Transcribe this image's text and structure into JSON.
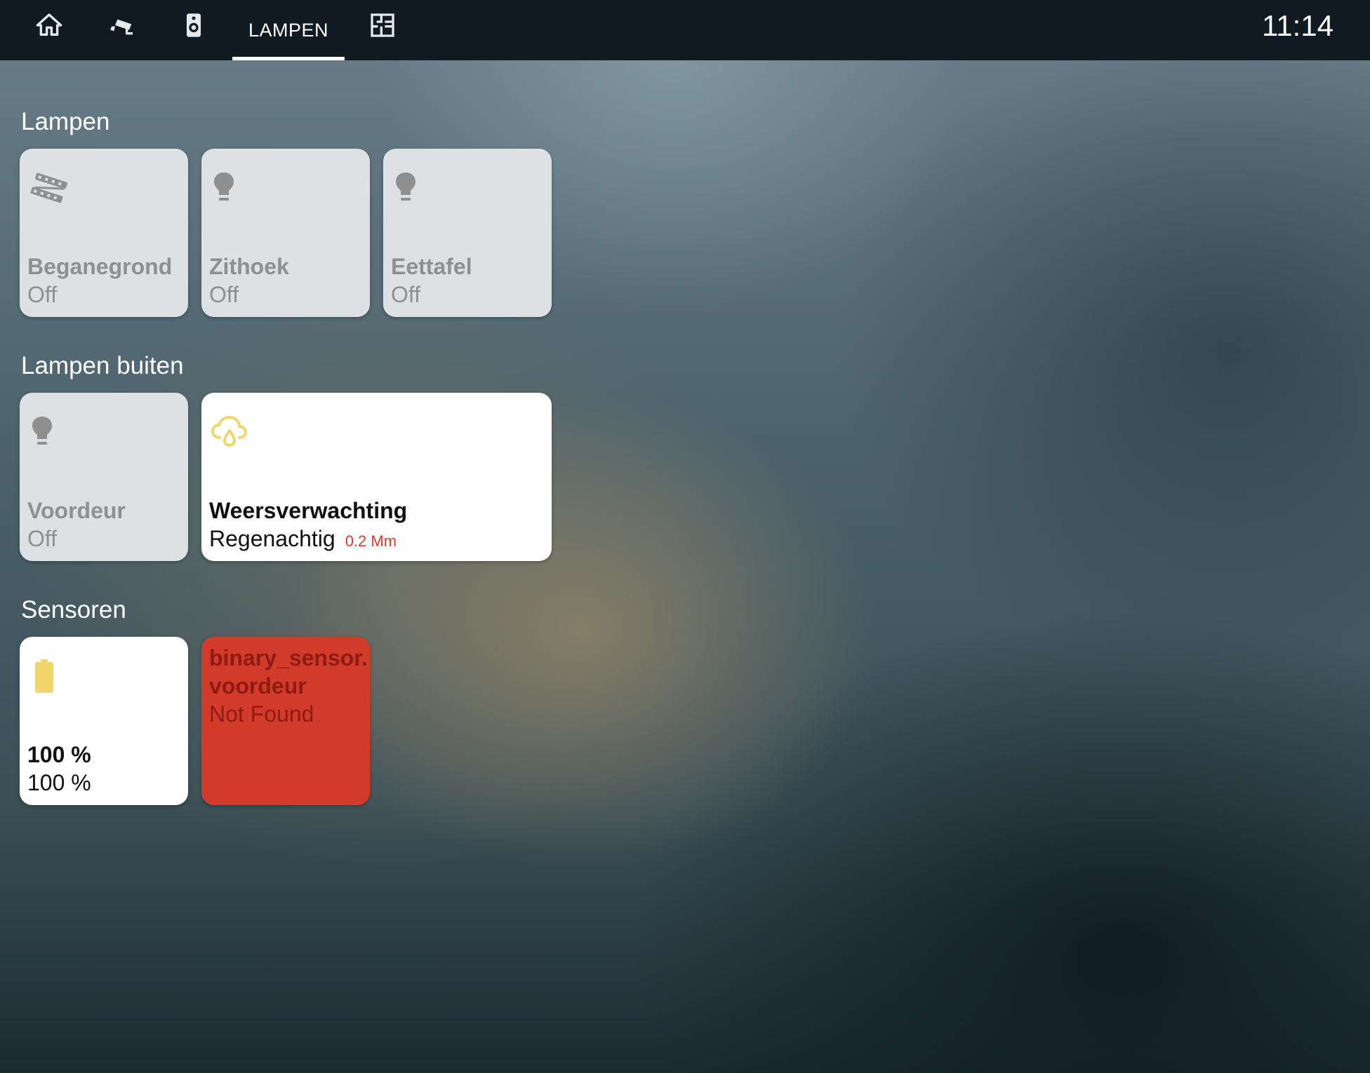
{
  "topbar": {
    "icons": [
      "home-icon",
      "cctv-icon",
      "speaker-icon",
      "floorplan-icon"
    ],
    "active_tab": "LAMPEN",
    "clock": "11:14"
  },
  "groups": [
    {
      "title": "Lampen",
      "tiles": [
        {
          "name": "Beganegrond",
          "state": "Off",
          "icon": "led-strip-icon"
        },
        {
          "name": "Zithoek",
          "state": "Off",
          "icon": "bulb-icon"
        },
        {
          "name": "Eettafel",
          "state": "Off",
          "icon": "bulb-icon"
        }
      ]
    },
    {
      "title": "Lampen buiten",
      "tiles": [
        {
          "name": "Voordeur",
          "state": "Off",
          "icon": "bulb-icon"
        },
        {
          "name": "Weersverwachting",
          "state": "Regenachtig",
          "extra": "0.2 Mm",
          "icon": "weather-rain-icon"
        }
      ]
    },
    {
      "title": "Sensoren",
      "tiles": [
        {
          "name": "100 %",
          "state": "100 %",
          "icon": "battery-icon"
        },
        {
          "name_line1": "binary_sensor.",
          "name_line2": "voordeur",
          "state": "Not Found"
        }
      ]
    }
  ],
  "colors": {
    "topbar": "#101a22",
    "tile_off": "#dee1e4",
    "tile_on": "#ffffff",
    "tile_error": "#d23a2a",
    "icon_off": "#8f8f8f",
    "icon_on": "#f1d66b",
    "accent_text": "#e0392b"
  }
}
